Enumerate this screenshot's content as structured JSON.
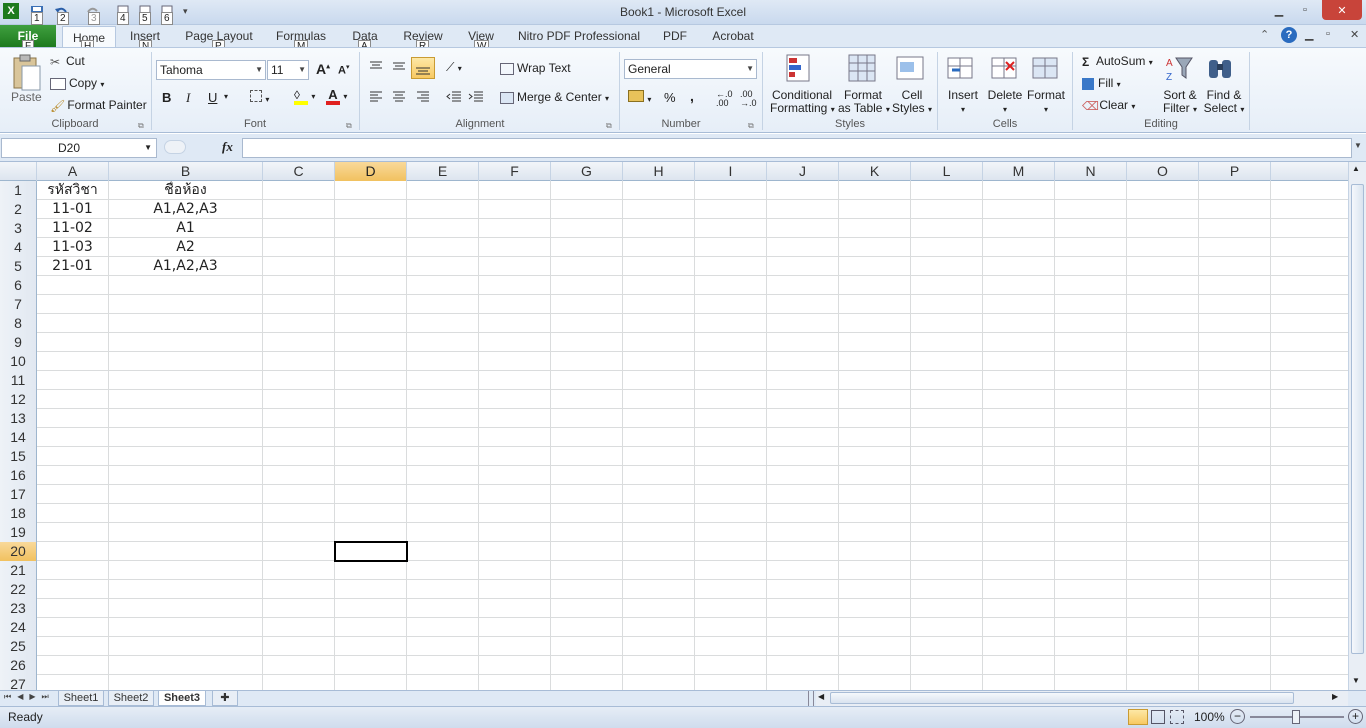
{
  "window": {
    "title": "Book1 - Microsoft Excel"
  },
  "qat": {
    "keytips": [
      "1",
      "2",
      "3",
      "4",
      "5",
      "6"
    ]
  },
  "tabs": [
    {
      "label": "File",
      "key": "F"
    },
    {
      "label": "Home",
      "key": "H"
    },
    {
      "label": "Insert",
      "key": "N"
    },
    {
      "label": "Page Layout",
      "key": "P"
    },
    {
      "label": "Formulas",
      "key": "M"
    },
    {
      "label": "Data",
      "key": "A"
    },
    {
      "label": "Review",
      "key": "R"
    },
    {
      "label": "View",
      "key": "W"
    },
    {
      "label": "Nitro PDF Professional"
    },
    {
      "label": "PDF"
    },
    {
      "label": "Acrobat"
    }
  ],
  "ribbon": {
    "clipboard": {
      "label": "Clipboard",
      "paste": "Paste",
      "cut": "Cut",
      "copy": "Copy",
      "format_painter": "Format Painter"
    },
    "font": {
      "label": "Font",
      "name": "Tahoma",
      "size": "11",
      "bold": "B",
      "italic": "I",
      "underline": "U"
    },
    "alignment": {
      "label": "Alignment",
      "wrap": "Wrap Text",
      "merge": "Merge & Center"
    },
    "number": {
      "label": "Number",
      "format": "General",
      "percent": "%",
      "comma": ","
    },
    "styles": {
      "label": "Styles",
      "conditional_1": "Conditional",
      "conditional_2": "Formatting",
      "format_table_1": "Format",
      "format_table_2": "as Table",
      "cell_styles_1": "Cell",
      "cell_styles_2": "Styles"
    },
    "cells": {
      "label": "Cells",
      "insert": "Insert",
      "delete": "Delete",
      "format": "Format"
    },
    "editing": {
      "label": "Editing",
      "autosum": "AutoSum",
      "fill": "Fill",
      "clear": "Clear",
      "sort_1": "Sort &",
      "sort_2": "Filter",
      "find_1": "Find &",
      "find_2": "Select"
    }
  },
  "formula_bar": {
    "name_box": "D20",
    "fx": "fx",
    "value": ""
  },
  "columns": [
    "A",
    "B",
    "C",
    "D",
    "E",
    "F",
    "G",
    "H",
    "I",
    "J",
    "K",
    "L",
    "M",
    "N",
    "O",
    "P"
  ],
  "selected_cell": {
    "col": "D",
    "row": 20
  },
  "cells": {
    "1": {
      "A": "รหัสวิชา",
      "B": "ชื่อห้อง"
    },
    "2": {
      "A": "11-01",
      "B": "A1,A2,A3"
    },
    "3": {
      "A": "11-02",
      "B": "A1"
    },
    "4": {
      "A": "11-03",
      "B": "A2"
    },
    "5": {
      "A": "21-01",
      "B": "A1,A2,A3"
    }
  },
  "row_count": 27,
  "sheets": [
    {
      "name": "Sheet1"
    },
    {
      "name": "Sheet2"
    },
    {
      "name": "Sheet3",
      "active": true
    }
  ],
  "status": {
    "ready": "Ready",
    "zoom": "100%"
  }
}
